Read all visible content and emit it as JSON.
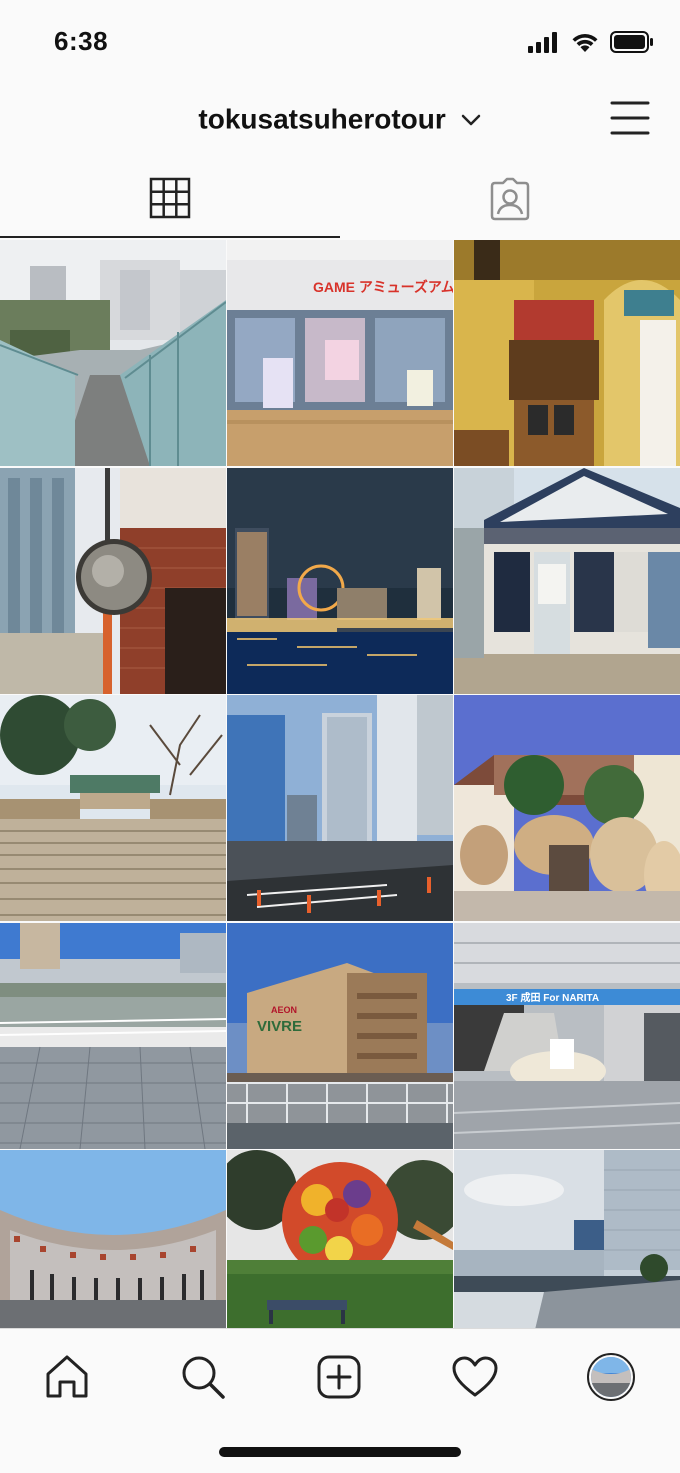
{
  "status_bar": {
    "time": "6:38",
    "icons": [
      "cellular-signal-icon",
      "wifi-icon",
      "battery-icon"
    ]
  },
  "header": {
    "username": "tokusatsuherotour",
    "username_dropdown_icon": "chevron-down-icon",
    "menu_icon": "hamburger-menu-icon"
  },
  "tabs": [
    {
      "icon": "grid-icon",
      "active": true
    },
    {
      "icon": "tagged-person-icon",
      "active": false
    }
  ],
  "grid": {
    "signs": {
      "game_store": "GAME アミューズアム",
      "vivre": "VIVRE",
      "aeon": "AEON",
      "narita": "3F 成田 For NARITA"
    }
  },
  "bottom_nav": [
    {
      "icon": "home-icon"
    },
    {
      "icon": "search-icon"
    },
    {
      "icon": "new-post-icon"
    },
    {
      "icon": "activity-heart-icon"
    },
    {
      "icon": "profile-avatar"
    }
  ],
  "colors": {
    "background": "#fafafa",
    "text": "#111111",
    "divider": "#dbdbdb"
  }
}
